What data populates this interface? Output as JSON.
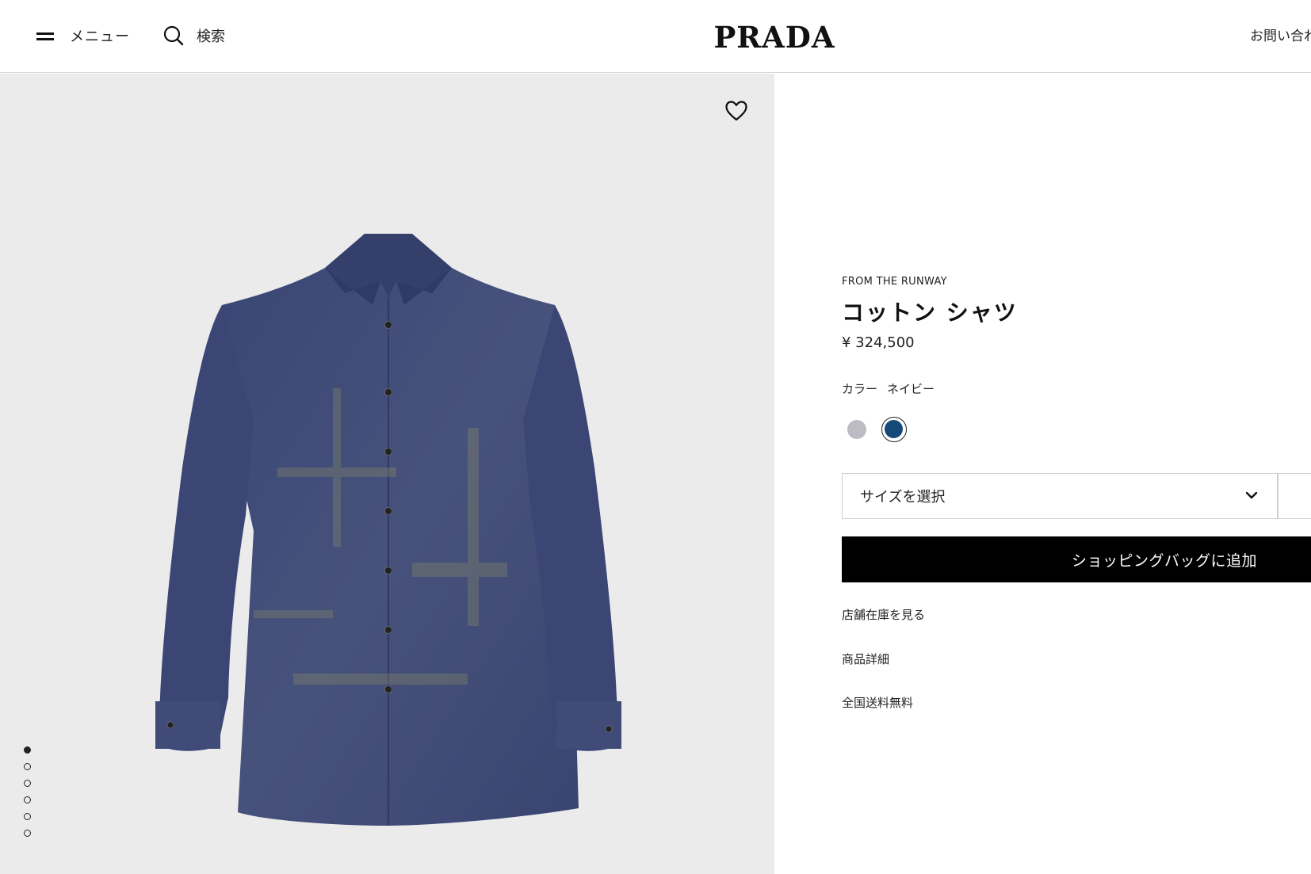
{
  "header": {
    "menu_label": "メニュー",
    "search_label": "検索",
    "logo_text": "PRADA",
    "contact_label": "お問い合わ"
  },
  "gallery": {
    "image_count": 6,
    "active_index": 0
  },
  "product": {
    "eyebrow": "FROM THE RUNWAY",
    "name": "コットン シャツ",
    "price": "¥ 324,500",
    "color_label": "カラー",
    "color_value": "ネイビー",
    "swatches": [
      {
        "name": "grey",
        "color": "#bdbcc4",
        "selected": false
      },
      {
        "name": "navy",
        "color": "#154a78",
        "selected": true
      }
    ]
  },
  "actions": {
    "size_select_label": "サイズを選択",
    "add_to_bag_label": "ショッピングバッグに追加"
  },
  "links": {
    "store_stock": "店舗在庫を見る",
    "details": "商品詳細",
    "shipping": "全国送料無料"
  },
  "colors": {
    "image_bg": "#ebebeb",
    "shirt": "#3d4a7a",
    "button_bg": "#000000"
  }
}
